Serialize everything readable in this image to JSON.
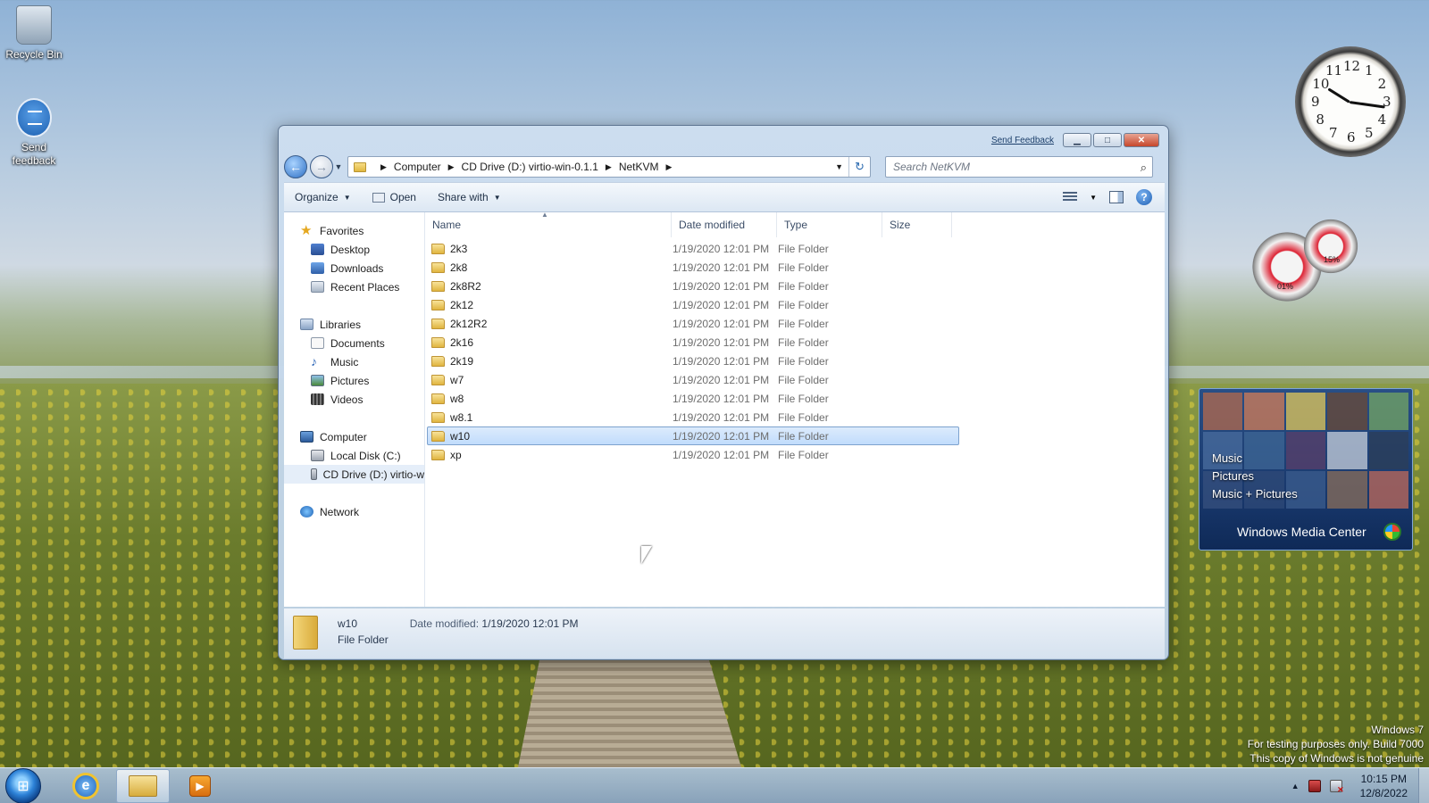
{
  "desktop": {
    "icons": [
      {
        "label": "Recycle Bin",
        "icon": "recycle-bin-icon"
      },
      {
        "label": "Send feedback",
        "icon": "send-feedback-icon"
      }
    ],
    "watermark": [
      "Windows 7",
      "For testing purposes only. Build 7000",
      "This copy of Windows is not genuine"
    ]
  },
  "window": {
    "send_feedback": "Send Feedback",
    "address": {
      "crumbs": [
        "Computer",
        "CD Drive (D:) virtio-win-0.1.1",
        "NetKVM"
      ]
    },
    "search_placeholder": "Search NetKVM",
    "toolbar": {
      "organize": "Organize",
      "open": "Open",
      "share_with": "Share with"
    },
    "navpane": {
      "favorites": "Favorites",
      "desktop": "Desktop",
      "downloads": "Downloads",
      "recent_places": "Recent Places",
      "libraries": "Libraries",
      "documents": "Documents",
      "music": "Music",
      "pictures": "Pictures",
      "videos": "Videos",
      "computer": "Computer",
      "local_disk": "Local Disk (C:)",
      "cd_drive": "CD Drive (D:) virtio-w",
      "network": "Network"
    },
    "columns": {
      "name": "Name",
      "date_modified": "Date modified",
      "type": "Type",
      "size": "Size"
    },
    "files": [
      {
        "name": "2k3",
        "date": "1/19/2020 12:01 PM",
        "type": "File Folder"
      },
      {
        "name": "2k8",
        "date": "1/19/2020 12:01 PM",
        "type": "File Folder"
      },
      {
        "name": "2k8R2",
        "date": "1/19/2020 12:01 PM",
        "type": "File Folder"
      },
      {
        "name": "2k12",
        "date": "1/19/2020 12:01 PM",
        "type": "File Folder"
      },
      {
        "name": "2k12R2",
        "date": "1/19/2020 12:01 PM",
        "type": "File Folder"
      },
      {
        "name": "2k16",
        "date": "1/19/2020 12:01 PM",
        "type": "File Folder"
      },
      {
        "name": "2k19",
        "date": "1/19/2020 12:01 PM",
        "type": "File Folder"
      },
      {
        "name": "w7",
        "date": "1/19/2020 12:01 PM",
        "type": "File Folder"
      },
      {
        "name": "w8",
        "date": "1/19/2020 12:01 PM",
        "type": "File Folder"
      },
      {
        "name": "w8.1",
        "date": "1/19/2020 12:01 PM",
        "type": "File Folder"
      },
      {
        "name": "w10",
        "date": "1/19/2020 12:01 PM",
        "type": "File Folder",
        "selected": true
      },
      {
        "name": "xp",
        "date": "1/19/2020 12:01 PM",
        "type": "File Folder"
      }
    ],
    "details": {
      "name": "w10",
      "type": "File Folder",
      "modified_label": "Date modified:",
      "modified_value": "1/19/2020 12:01 PM"
    }
  },
  "gadgets": {
    "clock_numbers": [
      "12",
      "1",
      "2",
      "3",
      "4",
      "5",
      "6",
      "7",
      "8",
      "9",
      "10",
      "11"
    ],
    "meter_cpu": "01%",
    "meter_mem": "15%",
    "media_center": {
      "menu": [
        "Music",
        "Pictures",
        "Music + Pictures"
      ],
      "brand": "Windows Media Center"
    }
  },
  "taskbar": {
    "time": "10:15 PM",
    "date": "12/8/2022"
  },
  "colors": {
    "selection": "#c1dcfc",
    "accent": "#2d6fc4"
  }
}
